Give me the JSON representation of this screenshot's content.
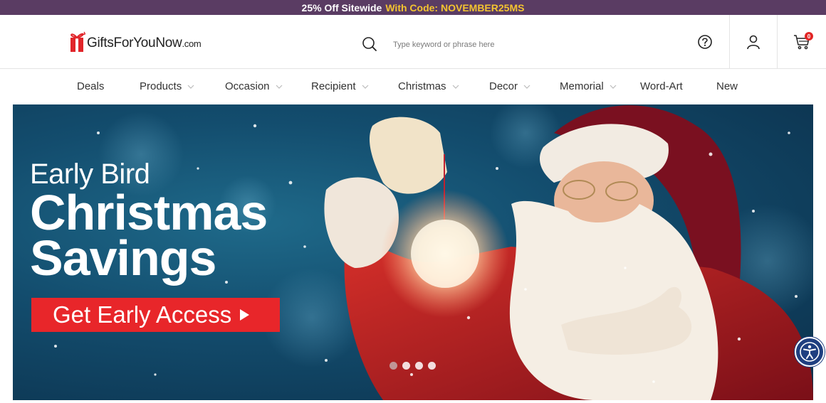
{
  "promo": {
    "text": "25% Off Sitewide",
    "code_text": "With Code: NOVEMBER25MS"
  },
  "logo": {
    "name": "GiftsForYouNow",
    "domain": ".com"
  },
  "search": {
    "placeholder": "Type keyword or phrase here"
  },
  "cart": {
    "count": "0"
  },
  "nav": {
    "items": [
      {
        "label": "Deals"
      },
      {
        "label": "Products"
      },
      {
        "label": "Occasion"
      },
      {
        "label": "Recipient"
      },
      {
        "label": "Christmas"
      },
      {
        "label": "Decor"
      },
      {
        "label": "Memorial"
      },
      {
        "label": "Word-Art"
      },
      {
        "label": "New"
      }
    ]
  },
  "hero": {
    "line1": "Early Bird",
    "line2": "Christmas",
    "line3": "Savings",
    "cta_label": "Get Early Access"
  },
  "colors": {
    "promo_bg": "#5a3c63",
    "promo_code": "#f4c430",
    "cta_red": "#e8262a",
    "a11y_blue": "#1f3f80"
  }
}
